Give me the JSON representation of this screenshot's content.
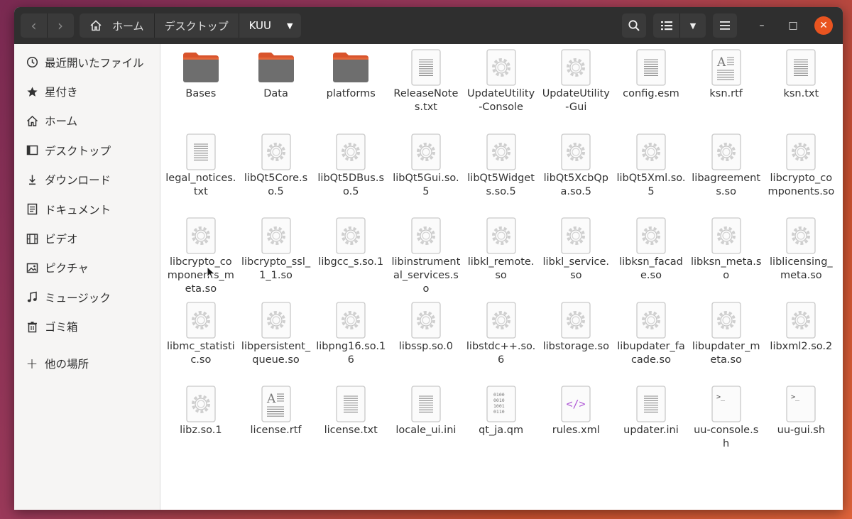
{
  "header": {
    "back_glyph": "‹",
    "forward_glyph": "›",
    "breadcrumbs": [
      "ホーム",
      "デスクトップ",
      "KUU"
    ],
    "caret": "▼",
    "view_caret": "▼",
    "minimize": "–",
    "maximize": "□",
    "close": "✕"
  },
  "sidebar": {
    "items": [
      {
        "label": "最近開いたファイル",
        "icon": "clock-icon"
      },
      {
        "label": "星付き",
        "icon": "star-icon"
      },
      {
        "label": "ホーム",
        "icon": "home-icon"
      },
      {
        "label": "デスクトップ",
        "icon": "desktop-icon"
      },
      {
        "label": "ダウンロード",
        "icon": "download-icon"
      },
      {
        "label": "ドキュメント",
        "icon": "document-icon"
      },
      {
        "label": "ビデオ",
        "icon": "film-icon"
      },
      {
        "label": "ピクチャ",
        "icon": "picture-icon"
      },
      {
        "label": "ミュージック",
        "icon": "music-icon"
      },
      {
        "label": "ゴミ箱",
        "icon": "trash-icon"
      }
    ],
    "other_locations": "他の場所",
    "other_icon_glyph": "+"
  },
  "files": [
    {
      "name": "Bases",
      "type": "folder"
    },
    {
      "name": "Data",
      "type": "folder"
    },
    {
      "name": "platforms",
      "type": "folder"
    },
    {
      "name": "ReleaseNotes.txt",
      "type": "text"
    },
    {
      "name": "UpdateUtility-Console",
      "type": "exec"
    },
    {
      "name": "UpdateUtility-Gui",
      "type": "exec"
    },
    {
      "name": "config.esm",
      "type": "text"
    },
    {
      "name": "ksn.rtf",
      "type": "rtf"
    },
    {
      "name": "ksn.txt",
      "type": "text"
    },
    {
      "name": "legal_notices.txt",
      "type": "text"
    },
    {
      "name": "libQt5Core.so.5",
      "type": "exec"
    },
    {
      "name": "libQt5DBus.so.5",
      "type": "exec"
    },
    {
      "name": "libQt5Gui.so.5",
      "type": "exec"
    },
    {
      "name": "libQt5Widgets.so.5",
      "type": "exec"
    },
    {
      "name": "libQt5XcbQpa.so.5",
      "type": "exec"
    },
    {
      "name": "libQt5Xml.so.5",
      "type": "exec"
    },
    {
      "name": "libagreements.so",
      "type": "exec"
    },
    {
      "name": "libcrypto_components.so",
      "type": "exec"
    },
    {
      "name": "libcrypto_components_meta.so",
      "type": "exec"
    },
    {
      "name": "libcrypto_ssl_1_1.so",
      "type": "exec"
    },
    {
      "name": "libgcc_s.so.1",
      "type": "exec"
    },
    {
      "name": "libinstrumental_services.so",
      "type": "exec"
    },
    {
      "name": "libkl_remote.so",
      "type": "exec"
    },
    {
      "name": "libkl_service.so",
      "type": "exec"
    },
    {
      "name": "libksn_facade.so",
      "type": "exec"
    },
    {
      "name": "libksn_meta.so",
      "type": "exec"
    },
    {
      "name": "liblicensing_meta.so",
      "type": "exec"
    },
    {
      "name": "libmc_statistic.so",
      "type": "exec"
    },
    {
      "name": "libpersistent_queue.so",
      "type": "exec"
    },
    {
      "name": "libpng16.so.16",
      "type": "exec"
    },
    {
      "name": "libssp.so.0",
      "type": "exec"
    },
    {
      "name": "libstdc++.so.6",
      "type": "exec"
    },
    {
      "name": "libstorage.so",
      "type": "exec"
    },
    {
      "name": "libupdater_facade.so",
      "type": "exec"
    },
    {
      "name": "libupdater_meta.so",
      "type": "exec"
    },
    {
      "name": "libxml2.so.2",
      "type": "exec"
    },
    {
      "name": "libz.so.1",
      "type": "exec"
    },
    {
      "name": "license.rtf",
      "type": "rtf"
    },
    {
      "name": "license.txt",
      "type": "text"
    },
    {
      "name": "locale_ui.ini",
      "type": "text"
    },
    {
      "name": "qt_ja.qm",
      "type": "binary"
    },
    {
      "name": "rules.xml",
      "type": "xml"
    },
    {
      "name": "updater.ini",
      "type": "text"
    },
    {
      "name": "uu-console.sh",
      "type": "script"
    },
    {
      "name": "uu-gui.sh",
      "type": "script"
    }
  ],
  "colors": {
    "folder_top": "#d9542c",
    "folder_body": "#6e6e6e",
    "close_button": "#e95420",
    "headerbar": "#2f2f2f",
    "xml_icon": "#b05bd6"
  }
}
